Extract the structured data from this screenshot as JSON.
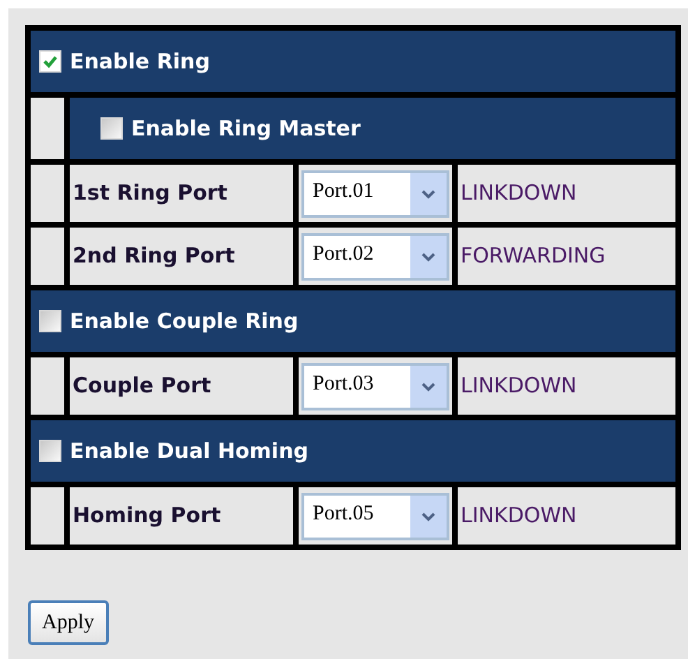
{
  "items": [
    {
      "kind": "section",
      "label": "Enable Ring",
      "checked": true
    },
    {
      "kind": "subsection",
      "label": "Enable Ring Master",
      "checked": false
    },
    {
      "kind": "port",
      "label": "1st Ring Port",
      "value": "Port.01",
      "status": "LINKDOWN"
    },
    {
      "kind": "port",
      "label": "2nd Ring Port",
      "value": "Port.02",
      "status": "FORWARDING"
    },
    {
      "kind": "section",
      "label": "Enable Couple Ring",
      "checked": false
    },
    {
      "kind": "port",
      "label": "Couple Port",
      "value": "Port.03",
      "status": "LINKDOWN"
    },
    {
      "kind": "section",
      "label": "Enable Dual Homing",
      "checked": false
    },
    {
      "kind": "port",
      "label": "Homing Port",
      "value": "Port.05",
      "status": "LINKDOWN"
    }
  ],
  "apply_button": "Apply"
}
